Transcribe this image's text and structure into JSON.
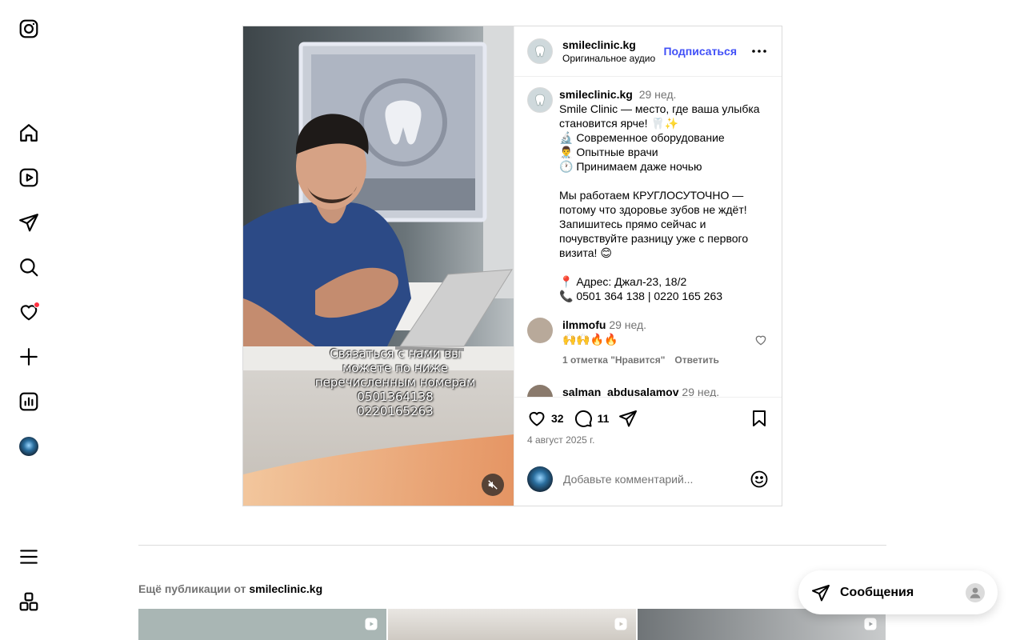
{
  "nav": {
    "items": [
      "instagram",
      "home",
      "reels",
      "direct",
      "search",
      "notifications",
      "create",
      "dashboard",
      "profile",
      "menu",
      "more-apps"
    ]
  },
  "post": {
    "username": "smileclinic.kg",
    "audio": "Оригинальное аудио",
    "follow": "Подписаться",
    "video_overlay": [
      "Связаться с нами вы",
      "можете по ниже",
      "перечисленным номерам",
      "0501364138",
      "0220165263"
    ],
    "caption": {
      "username": "smileclinic.kg",
      "time": "29 нед.",
      "lines": [
        "Smile Clinic — место, где ваша улыбка становится ярче! 🦷✨",
        "🔬 Современное оборудование",
        "👨‍⚕️ Опытные врачи",
        "🕐 Принимаем даже ночью",
        "",
        "Мы работаем КРУГЛОСУТОЧНО — потому что здоровье зубов не ждёт! Запишитесь прямо сейчас и почувствуйте разницу уже с первого визита! 😊",
        "",
        "📍 Адрес: Джал-23, 18/2",
        "📞 0501 364 138 | 0220 165 263"
      ]
    },
    "comments": [
      {
        "username": "ilmmofu",
        "time": "29 нед.",
        "text": "🙌🙌🔥🔥",
        "likes": "1 отметка \"Нравится\"",
        "reply": "Ответить"
      },
      {
        "username": "salman_abdusalamov",
        "time": "29 нед.",
        "text": "",
        "likes": "",
        "reply": ""
      }
    ],
    "like_count": "32",
    "comment_count": "11",
    "date": "4 август 2025 г.",
    "comment_placeholder": "Добавьте комментарий..."
  },
  "more_posts": {
    "prefix": "Ещё публикации от",
    "username": "smileclinic.kg"
  },
  "messages": {
    "label": "Сообщения"
  },
  "colors": {
    "accent": "#4150f7",
    "notification": "#ff3040",
    "muted": "#737373"
  }
}
